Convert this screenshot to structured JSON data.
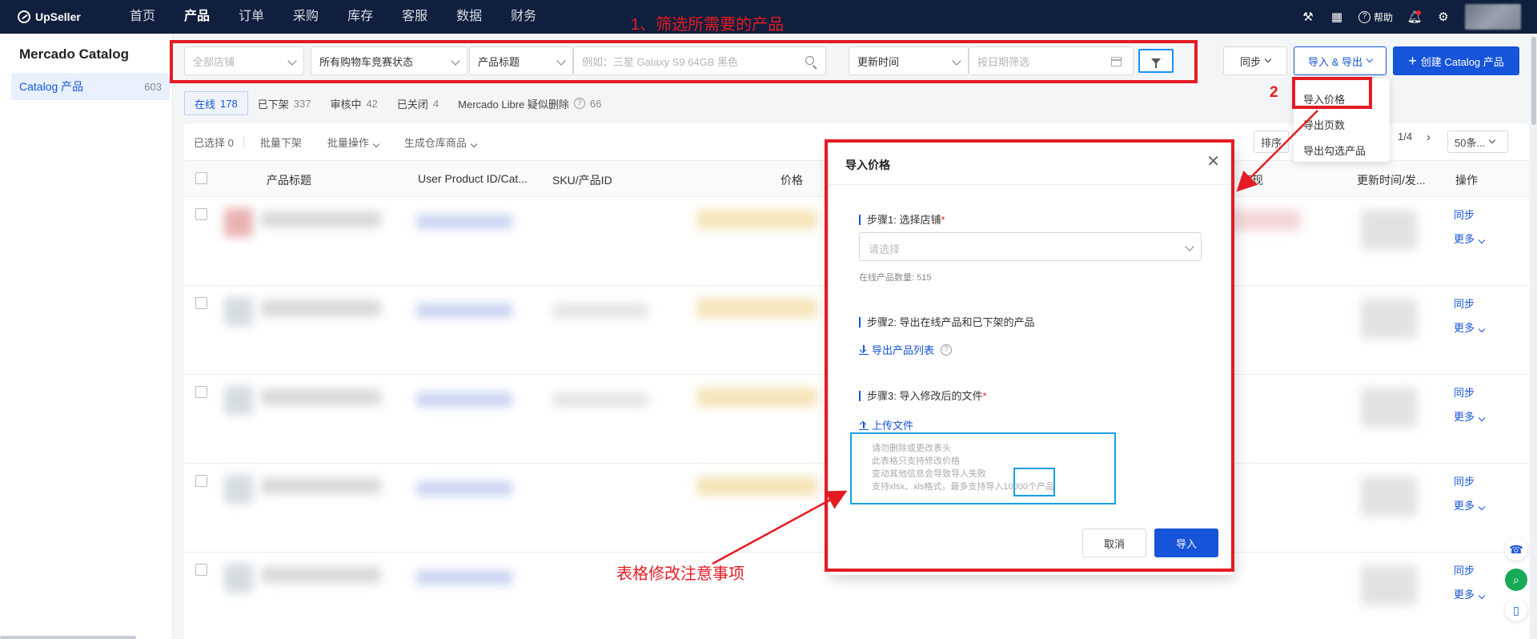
{
  "app": {
    "logo_text": "UpSeller"
  },
  "nav": {
    "items": [
      "首页",
      "产品",
      "订单",
      "采购",
      "库存",
      "客服",
      "数据",
      "财务"
    ],
    "active_index": 1
  },
  "topbar": {
    "help_label": "帮助"
  },
  "sidebar": {
    "title": "Mercado Catalog",
    "item_label": "Catalog 产品",
    "item_count": "603"
  },
  "filters": {
    "store_placeholder": "全部店铺",
    "buybox_status": "所有购物车竞赛状态",
    "field": "产品标题",
    "search_placeholder": "例如：三星 Galaxy S9 64GB 黑色",
    "time_field": "更新时间",
    "date_placeholder": "按日期筛选"
  },
  "actions": {
    "sync": "同步",
    "import_export": "导入 & 导出",
    "create": "创建 Catalog 产品"
  },
  "dropdown": {
    "items": [
      "导入价格",
      "导出页数",
      "导出勾选产品"
    ]
  },
  "status_tabs": [
    {
      "label": "在线",
      "count": "178"
    },
    {
      "label": "已下架",
      "count": "337"
    },
    {
      "label": "审核中",
      "count": "42"
    },
    {
      "label": "已关闭",
      "count": "4"
    },
    {
      "label": "Mercado Libre 疑似删除",
      "count": "66"
    }
  ],
  "toolbar": {
    "selected": "已选择 0",
    "bulk_unlist": "批量下架",
    "bulk_ops": "批量操作",
    "gen_warehouse": "生成仓库商品",
    "sort": "排序",
    "page": "1/4",
    "page_size": "50条..."
  },
  "table": {
    "headers": {
      "title": "产品标题",
      "upid": "User Product ID/Cat...",
      "sku": "SKU/产品ID",
      "price": "价格",
      "perf": "表现",
      "updated": "更新时间/发...",
      "op": "操作"
    },
    "row_actions": {
      "sync": "同步",
      "more": "更多"
    }
  },
  "modal": {
    "title": "导入价格",
    "step1": "步骤1: 选择店铺",
    "step1_placeholder": "请选择",
    "online_count": "在线产品数量: 515",
    "step2": "步骤2: 导出在线产品和已下架的产品",
    "export_link": "导出产品列表",
    "step3": "步骤3: 导入修改后的文件",
    "upload_link": "上传文件",
    "tips": [
      "请勿删除或更改表头",
      "此表格只支持修改价格",
      "变动其他信息会导致导入失败",
      "支持xlsx、xls格式，最多支持导入10000个产品"
    ],
    "cancel": "取消",
    "import": "导入"
  },
  "annotations": {
    "step1_text": "1、筛选所需要的产品",
    "step2_num": "2",
    "note_text": "表格修改注意事项"
  },
  "colors": {
    "topbar": "#0f1f3d",
    "primary": "#1654d9",
    "annotation_red": "#e41b23",
    "annotation_blue": "#1a9ee0"
  }
}
